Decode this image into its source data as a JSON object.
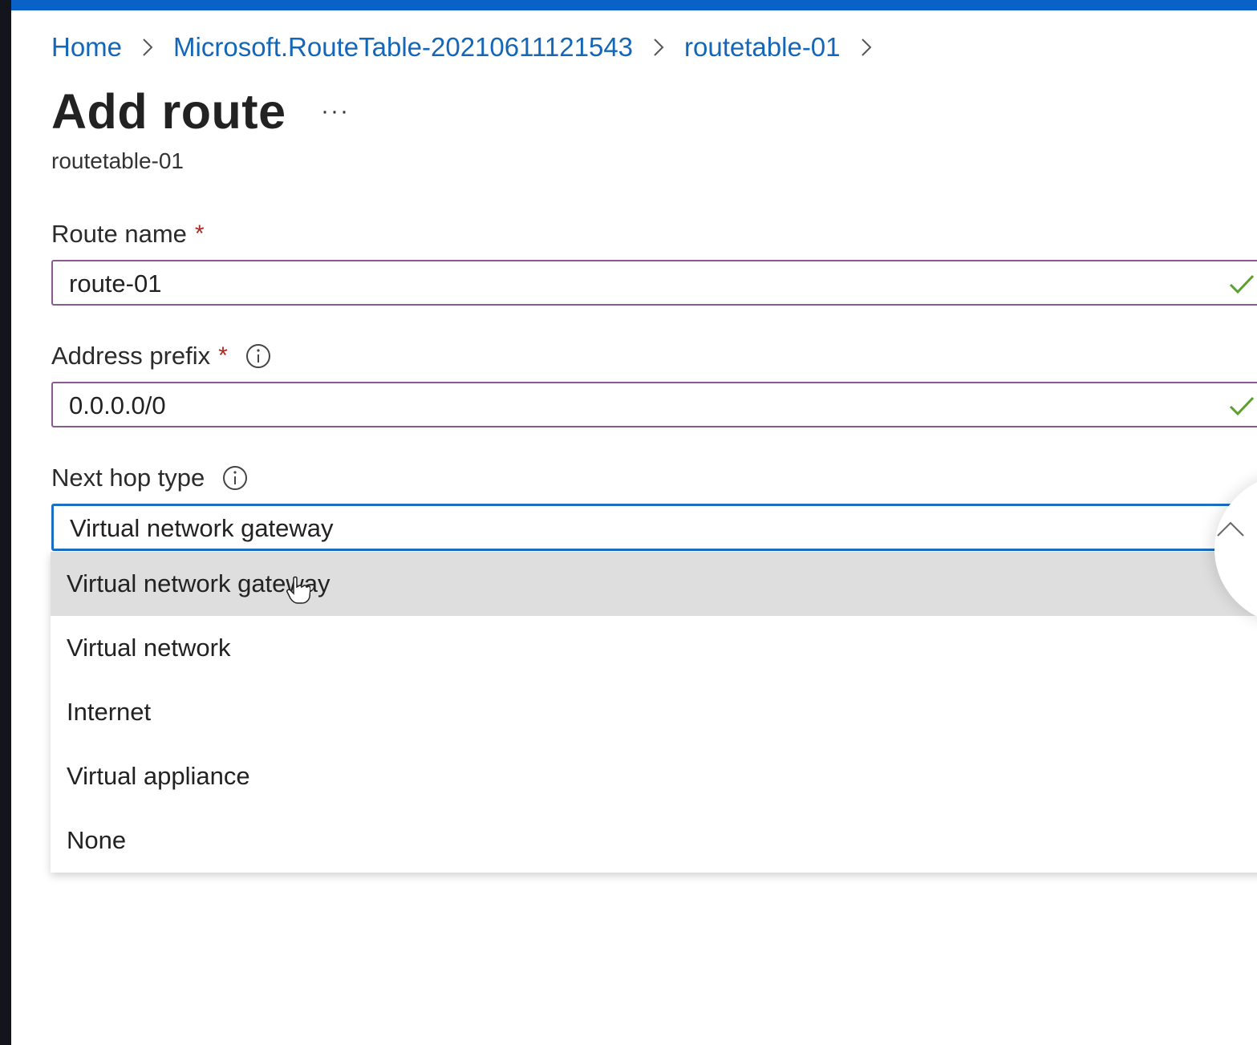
{
  "breadcrumb": {
    "items": [
      "Home",
      "Microsoft.RouteTable-20210611121543",
      "routetable-01"
    ]
  },
  "page": {
    "title": "Add route",
    "more_label": "···",
    "subtitle": "routetable-01"
  },
  "form": {
    "route_name": {
      "label": "Route name",
      "required_mark": "*",
      "value": "route-01"
    },
    "address_prefix": {
      "label": "Address prefix",
      "required_mark": "*",
      "value": "0.0.0.0/0"
    },
    "next_hop_type": {
      "label": "Next hop type",
      "selected": "Virtual network gateway",
      "options": [
        "Virtual network gateway",
        "Virtual network",
        "Internet",
        "Virtual appliance",
        "None"
      ]
    }
  },
  "icons": {
    "separator": "chevron-right-icon",
    "info": "info-icon",
    "valid": "check-icon",
    "dropdown_toggle": "chevron-up-icon",
    "pointer": "hand-cursor-icon"
  },
  "colors": {
    "accent": "#0a62c9",
    "link": "#1467b8",
    "required": "#b3261e",
    "valid_check": "#5aa02c",
    "field_border": "#8a5a8f",
    "focus_border": "#1d6fc2",
    "option_hover": "#dedede"
  }
}
